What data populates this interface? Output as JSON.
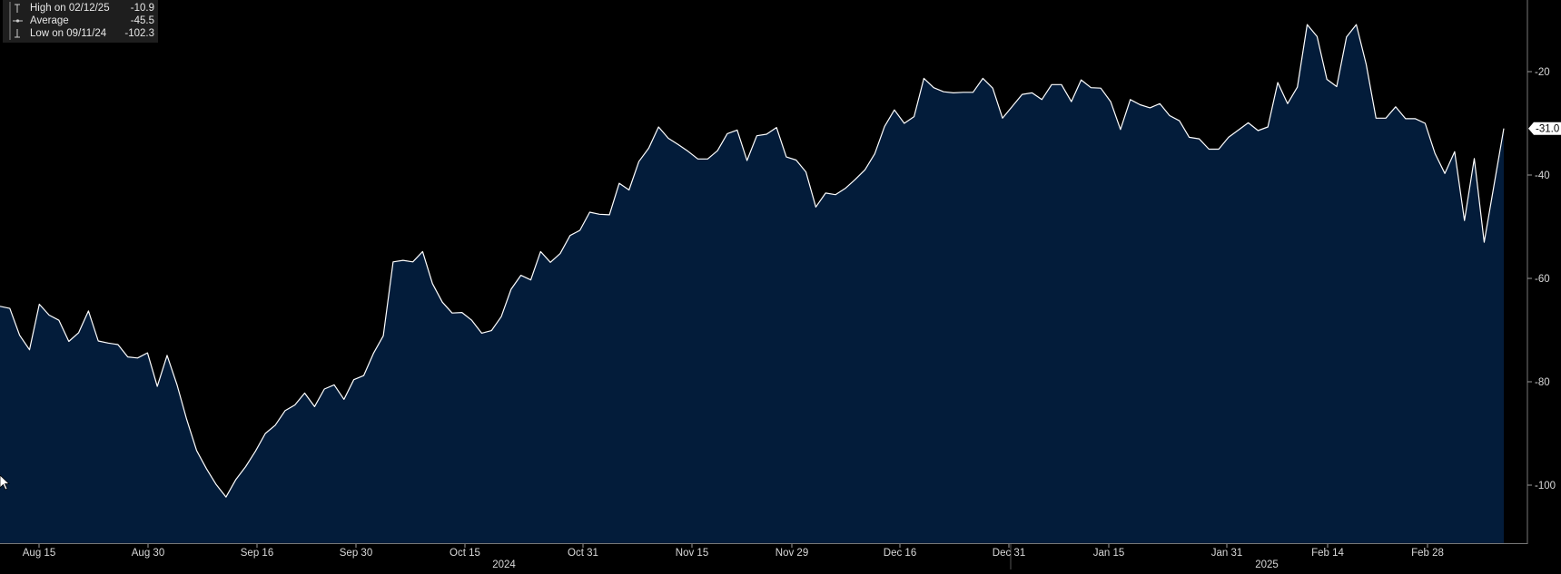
{
  "legend": {
    "high": {
      "label": "High on 02/12/25",
      "value": "-10.9"
    },
    "average": {
      "label": "Average",
      "value": "-45.5"
    },
    "low": {
      "label": "Low on 09/11/24",
      "value": "-102.3"
    }
  },
  "last_value_label": "-31.0",
  "colors": {
    "background": "#000000",
    "area_fill": "#031c3a",
    "line": "#ffffff",
    "axis_text": "#d8d8d8",
    "legend_bg": "#1e1e1e"
  },
  "chart_data": {
    "type": "area",
    "title": "",
    "xlabel": "",
    "ylabel": "",
    "ylim": [
      -112,
      0
    ],
    "y_axis_side": "right",
    "grid": false,
    "legend_position": "top-left",
    "x_tick_labels": [
      "Aug 15",
      "Aug 30",
      "Sep 16",
      "Sep 30",
      "Oct 15",
      "Oct 31",
      "Nov 15",
      "Nov 29",
      "Dec 16",
      "Dec 31",
      "Jan 15",
      "Jan 31",
      "Feb 14",
      "Feb 28"
    ],
    "x_year_labels": [
      "2024",
      "2025"
    ],
    "y_ticks": [
      -20,
      -40,
      -60,
      -80,
      -100
    ],
    "y_tick_labels": [
      "-20",
      "-40",
      "-60",
      "-80",
      "-100"
    ],
    "series": [
      {
        "values": [
          -65.4,
          -65.8,
          -71.0,
          -73.8,
          -65.0,
          -67.1,
          -68.1,
          -72.2,
          -70.5,
          -66.3,
          -72.1,
          -72.5,
          -72.8,
          -75.2,
          -75.4,
          -74.4,
          -80.9,
          -74.9,
          -80.5,
          -87.3,
          -93.3,
          -96.8,
          -99.9,
          -102.3,
          -98.9,
          -96.4,
          -93.4,
          -90.0,
          -88.4,
          -85.6,
          -84.5,
          -82.2,
          -84.8,
          -81.4,
          -80.6,
          -83.4,
          -79.6,
          -78.8,
          -74.5,
          -71.1,
          -56.8,
          -56.5,
          -56.8,
          -54.8,
          -61.0,
          -64.6,
          -66.7,
          -66.6,
          -68.1,
          -70.6,
          -70.1,
          -67.4,
          -62.1,
          -59.4,
          -60.3,
          -54.8,
          -56.9,
          -55.2,
          -51.7,
          -50.7,
          -47.2,
          -47.6,
          -47.7,
          -41.6,
          -42.9,
          -37.4,
          -34.8,
          -30.7,
          -32.9,
          -34.1,
          -35.4,
          -36.9,
          -36.9,
          -35.3,
          -32.0,
          -31.3,
          -37.2,
          -32.4,
          -32.1,
          -30.8,
          -36.5,
          -37.1,
          -39.4,
          -46.2,
          -43.5,
          -43.8,
          -42.6,
          -40.9,
          -39.0,
          -35.9,
          -30.6,
          -27.4,
          -30.0,
          -28.7,
          -21.3,
          -23.1,
          -23.9,
          -24.1,
          -24.0,
          -24.0,
          -21.3,
          -23.2,
          -29.0,
          -26.7,
          -24.4,
          -24.1,
          -25.4,
          -22.5,
          -22.5,
          -25.8,
          -21.6,
          -23.1,
          -23.2,
          -25.8,
          -31.2,
          -25.4,
          -26.4,
          -27.0,
          -26.2,
          -28.5,
          -29.5,
          -32.7,
          -33.0,
          -35.0,
          -35.0,
          -32.7,
          -31.3,
          -29.9,
          -31.4,
          -30.7,
          -22.1,
          -26.2,
          -23.0,
          -10.9,
          -13.2,
          -21.5,
          -22.9,
          -13.3,
          -10.9,
          -18.6,
          -29.0,
          -29.0,
          -26.8,
          -29.1,
          -29.1,
          -30.0,
          -35.8,
          -39.7,
          -35.5,
          -48.8,
          -36.8,
          -53.0,
          -42.0,
          -31.0
        ]
      }
    ]
  }
}
